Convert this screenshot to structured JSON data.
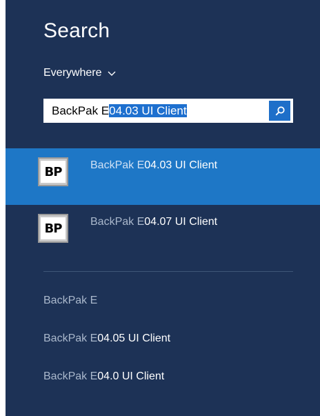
{
  "pane": {
    "title": "Search",
    "scope": {
      "label": "Everywhere",
      "icon": "chevron-down-icon"
    },
    "search_box": {
      "typed_text": "BackPak E",
      "selected_text": "04.03 UI Client",
      "button_icon": "search-icon"
    },
    "results": [
      {
        "icon_text": "BP",
        "match": "BackPak E",
        "rest": "04.03 UI Client",
        "selected": true
      },
      {
        "icon_text": "BP",
        "match": "BackPak E",
        "rest": "04.07 UI Client",
        "selected": false
      }
    ],
    "suggestions": [
      {
        "match": "BackPak E",
        "rest": ""
      },
      {
        "match": "BackPak E",
        "rest": "04.05 UI Client"
      },
      {
        "match": "BackPak E",
        "rest": "04.0 UI Client"
      }
    ]
  },
  "colors": {
    "pane_background": "#1d3256",
    "selected_result": "#1e77c6",
    "search_button": "#1e6fc9",
    "text_highlight": "#1e70cf",
    "muted_text": "#aab8cc"
  }
}
